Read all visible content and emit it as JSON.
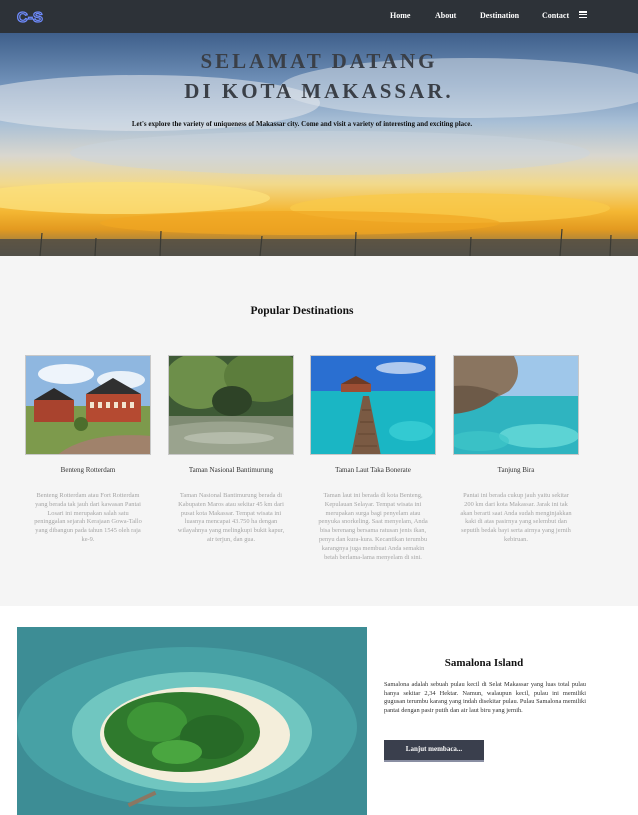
{
  "nav": {
    "logo": "C-S",
    "links": [
      "Home",
      "About",
      "Destination",
      "Contact"
    ],
    "menu_icon": "hamburger-icon"
  },
  "hero": {
    "title_line1": "SELAMAT DATANG",
    "title_line2": "DI KOTA MAKASSAR.",
    "subtitle": "Let's explore the variety of uniqueness of Makassar city. Come and visit a variety of interesting and exciting place."
  },
  "popular": {
    "title": "Popular Destinations",
    "cards": [
      {
        "name": "Benteng Rotterdam",
        "desc": "Benteng Rotterdam atau Fort Rotterdam yang berada tak jauh dari kawasan Pantai Losari ini merupakan salah satu peninggalan sejarah Kerajaan Gowa-Tallo yang dibangun pada tahun 1545 oleh raja ke-9."
      },
      {
        "name": "Taman Nasional Bantimurung",
        "desc": "Taman Nasional Bantimurung berada di Kabupaten Maros atau sekitar 45 km dari pusat kota Makassar. Tempat wisata ini luasnya mencapai 43.750 ha dengan wilayahnya yang melingkupi bukit kapur, air terjun, dan gua."
      },
      {
        "name": "Taman Laut Taka Bonerate",
        "desc": "Taman laut ini berada di kota Benteng, Kepulauan Selayar. Tempat wisata ini merupakan surga bagi penyelam atau penyuka snorkeling. Saat menyelam, Anda bisa berenang bersama ratusan jenis ikan, penyu dan kura-kura. Kecantikan terumbu karangnya juga membuat Anda semakin betah berlama-lama menyelam di sini."
      },
      {
        "name": "Tanjung Bira",
        "desc": "Pantai ini berada cukup jauh yaitu sekitar 200 km dari kota Makassar. Jarak ini tak akan berarti saat Anda sudah menginjakkan kaki di atas pasirnya yang selembut dan seputih bedak bayi serta airnya yang jernih kebiruan."
      }
    ]
  },
  "feature": {
    "title": "Samalona Island",
    "desc": "Samalona adalah sebuah pulau kecil di Selat Makassar yang luas total pulau hanya sekitar 2,34 Hektar. Namun, walaupun kecil, pulau ini memiliki gugusan terumbu karang yang indah disekitar pulau. Pulau Samalona memiliki pantai dengan pasir putih dan air laut biru yang jernih.",
    "button": "Lanjut membaca..."
  },
  "colors": {
    "nav_bg": "#2d3238",
    "section_bg": "#f5f5f5",
    "button_bg": "#3a3f4d",
    "logo_blue": "#4b6cf0"
  }
}
